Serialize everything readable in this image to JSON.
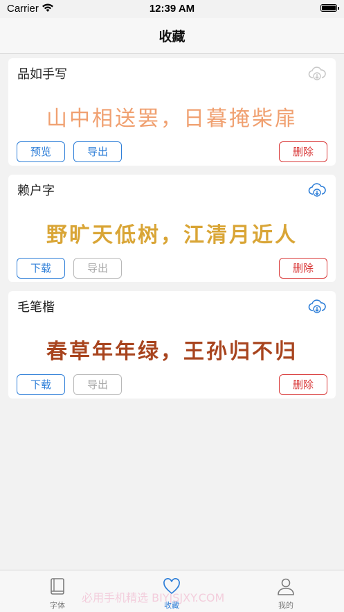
{
  "status_bar": {
    "carrier": "Carrier",
    "time": "12:39 AM"
  },
  "nav": {
    "title": "收藏"
  },
  "cards": [
    {
      "name": "品如手写",
      "sample": "山中相送罢，日暮掩柴扉",
      "sample_color": "#f0a070",
      "cloud_color": "#c8c8c8",
      "buttons": {
        "left": "预览",
        "middle": "导出",
        "delete": "删除"
      }
    },
    {
      "name": "赖户字",
      "sample": "野旷天低树，江清月近人",
      "sample_color": "#d9a536",
      "cloud_color": "#2f7fd8",
      "buttons": {
        "left": "下载",
        "middle": "导出",
        "delete": "删除"
      }
    },
    {
      "name": "毛笔楷",
      "sample": "春草年年绿，王孙归不归",
      "sample_color": "#a8441e",
      "cloud_color": "#2f7fd8",
      "buttons": {
        "left": "下载",
        "middle": "导出",
        "delete": "删除"
      }
    }
  ],
  "tabs": [
    {
      "label": "字体",
      "icon": "book-icon",
      "active": false
    },
    {
      "label": "收藏",
      "icon": "heart-icon",
      "active": true
    },
    {
      "label": "我的",
      "icon": "person-icon",
      "active": false
    }
  ],
  "watermark": "必用手机精选 BIYJSJXY.COM",
  "colors": {
    "accent": "#2f7fd8",
    "danger": "#d93a3a",
    "disabled": "#b8b8b8"
  }
}
